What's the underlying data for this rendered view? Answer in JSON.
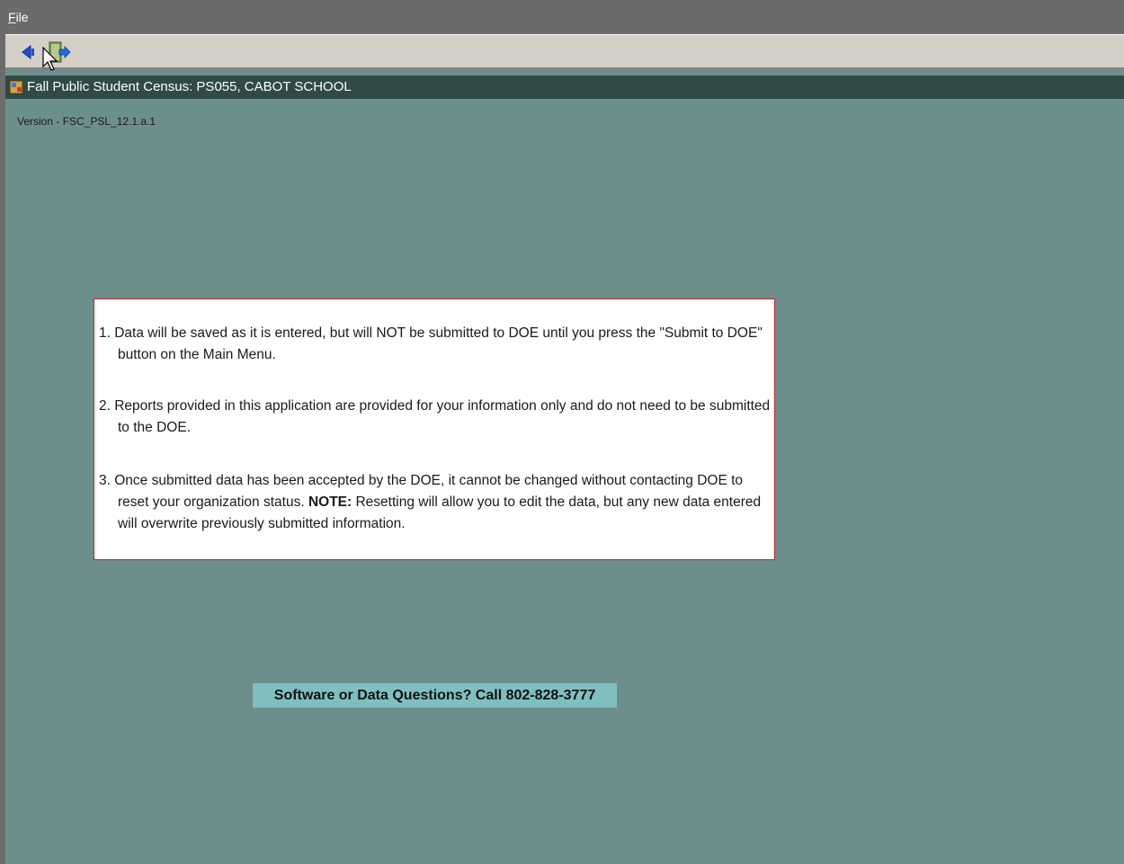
{
  "menubar": {
    "file_prefix": "F",
    "file_rest": "ile"
  },
  "toolbar": {
    "back_icon": "back-arrow-icon",
    "exit_icon": "exit-door-icon"
  },
  "window": {
    "title": "Fall Public Student Census:  PS055, CABOT SCHOOL",
    "icon": "app-icon"
  },
  "version": "Version - FSC_PSL_12.1.a.1",
  "notice": {
    "item1": "1. Data will be saved as it is entered, but will NOT be submitted to DOE until you press the \"Submit to DOE\" button on the Main Menu.",
    "item2": "2. Reports provided in this application are provided for your information only and do not need to be submitted to the DOE.",
    "item3_before": "3. Once submitted data has been accepted by the DOE, it cannot be changed without contacting DOE to reset your organization status.  ",
    "item3_note": "NOTE:",
    "item3_after": "  Resetting will allow you to edit the data, but any new data entered will overwrite previously submitted information."
  },
  "support": "Software or Data Questions?  Call 802-828-3777",
  "colors": {
    "background": "#6d8f8c",
    "titlebar": "#2f4a47",
    "notice_border": "#cc2222",
    "support_bg": "#7fbfbf"
  }
}
